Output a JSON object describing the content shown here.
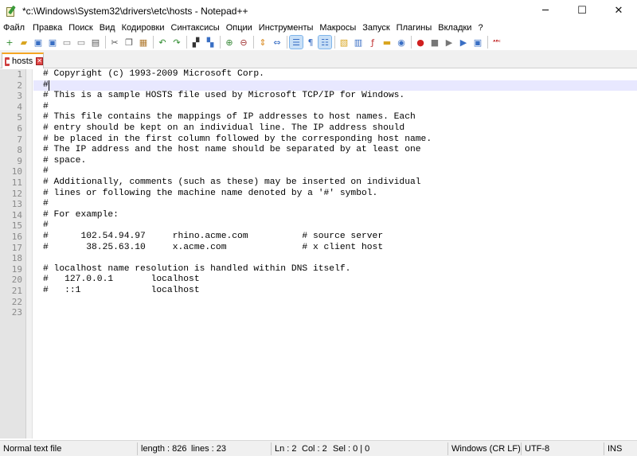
{
  "window": {
    "title": "*c:\\Windows\\System32\\drivers\\etc\\hosts - Notepad++",
    "minimize_glyph": "─",
    "maximize_glyph": "☐",
    "close_glyph": "✕"
  },
  "menu": [
    "Файл",
    "Правка",
    "Поиск",
    "Вид",
    "Кодировки",
    "Синтаксисы",
    "Опции",
    "Инструменты",
    "Макросы",
    "Запуск",
    "Плагины",
    "Вкладки",
    "?"
  ],
  "toolbar": {
    "buttons": [
      {
        "name": "new-file-icon",
        "glyph": "+",
        "color": "#2e8b2e"
      },
      {
        "name": "open-file-icon",
        "glyph": "▰",
        "color": "#d9a520"
      },
      {
        "name": "save-icon",
        "glyph": "▣",
        "color": "#3a6fc4"
      },
      {
        "name": "save-all-icon",
        "glyph": "▣",
        "color": "#3a6fc4"
      },
      {
        "name": "close-file-icon",
        "glyph": "▭",
        "color": "#7a7a7a"
      },
      {
        "name": "close-all-icon",
        "glyph": "▭",
        "color": "#7a7a7a"
      },
      {
        "name": "print-icon",
        "glyph": "▤",
        "color": "#555555"
      },
      {
        "sep": true
      },
      {
        "name": "cut-icon",
        "glyph": "✂",
        "color": "#555555"
      },
      {
        "name": "copy-icon",
        "glyph": "❐",
        "color": "#555555"
      },
      {
        "name": "paste-icon",
        "glyph": "▦",
        "color": "#b07a30"
      },
      {
        "sep": true
      },
      {
        "name": "undo-icon",
        "glyph": "↶",
        "color": "#2e8b2e"
      },
      {
        "name": "redo-icon",
        "glyph": "↷",
        "color": "#2e8b2e"
      },
      {
        "sep": true
      },
      {
        "name": "find-icon",
        "glyph": "▞",
        "color": "#333333"
      },
      {
        "name": "replace-icon",
        "glyph": "▚",
        "color": "#3a6fc4"
      },
      {
        "sep": true
      },
      {
        "name": "zoom-in-icon",
        "glyph": "⊕",
        "color": "#3a8a3a"
      },
      {
        "name": "zoom-out-icon",
        "glyph": "⊖",
        "color": "#a03030"
      },
      {
        "sep": true
      },
      {
        "name": "sync-vertical-icon",
        "glyph": "⇕",
        "color": "#d98a20"
      },
      {
        "name": "sync-horizontal-icon",
        "glyph": "⇔",
        "color": "#3a6fc4"
      },
      {
        "sep": true
      },
      {
        "name": "word-wrap-icon",
        "glyph": "☰",
        "color": "#3a6fc4",
        "active": true
      },
      {
        "name": "show-all-chars-icon",
        "glyph": "¶",
        "color": "#3a6fc4"
      },
      {
        "name": "indent-guide-icon",
        "glyph": "☷",
        "color": "#3a6fc4",
        "active": true
      },
      {
        "sep": true
      },
      {
        "name": "define-language-icon",
        "glyph": "▧",
        "color": "#d9a520"
      },
      {
        "name": "document-map-icon",
        "glyph": "▥",
        "color": "#3a6fc4"
      },
      {
        "name": "function-list-icon",
        "glyph": "ƒ",
        "color": "#c03030"
      },
      {
        "name": "folder-workspace-icon",
        "glyph": "▬",
        "color": "#d9a520"
      },
      {
        "name": "monitoring-icon",
        "glyph": "◉",
        "color": "#3a6fc4"
      },
      {
        "sep": true
      },
      {
        "name": "record-macro-icon",
        "glyph": "●",
        "color": "#d02020"
      },
      {
        "name": "stop-record-icon",
        "glyph": "■",
        "color": "#777777"
      },
      {
        "name": "play-macro-icon",
        "glyph": "▶",
        "color": "#777777"
      },
      {
        "name": "run-macro-multiple-icon",
        "glyph": "▶",
        "color": "#3a6fc4"
      },
      {
        "name": "save-macro-icon",
        "glyph": "▣",
        "color": "#3a6fc4"
      },
      {
        "sep": true
      },
      {
        "name": "spell-check-icon",
        "glyph": "ᴬᴮᶜ",
        "color": "#c02020"
      }
    ]
  },
  "tab": {
    "label": "hosts",
    "close_glyph": "✕"
  },
  "editor": {
    "current_line": 2,
    "lines": [
      "# Copyright (c) 1993-2009 Microsoft Corp.",
      "#",
      "# This is a sample HOSTS file used by Microsoft TCP/IP for Windows.",
      "#",
      "# This file contains the mappings of IP addresses to host names. Each",
      "# entry should be kept on an individual line. The IP address should",
      "# be placed in the first column followed by the corresponding host name.",
      "# The IP address and the host name should be separated by at least one",
      "# space.",
      "#",
      "# Additionally, comments (such as these) may be inserted on individual",
      "# lines or following the machine name denoted by a '#' symbol.",
      "#",
      "# For example:",
      "#",
      "#      102.54.94.97     rhino.acme.com          # source server",
      "#       38.25.63.10     x.acme.com              # x client host",
      "",
      "# localhost name resolution is handled within DNS itself.",
      "#   127.0.0.1       localhost",
      "#   ::1             localhost",
      "",
      ""
    ]
  },
  "status": {
    "file_type": "Normal text file",
    "length": "length : 826",
    "lines": "lines : 23",
    "ln": "Ln : 2",
    "col": "Col : 2",
    "sel": "Sel : 0 | 0",
    "eol": "Windows (CR LF)",
    "encoding": "UTF-8",
    "mode": "INS"
  }
}
